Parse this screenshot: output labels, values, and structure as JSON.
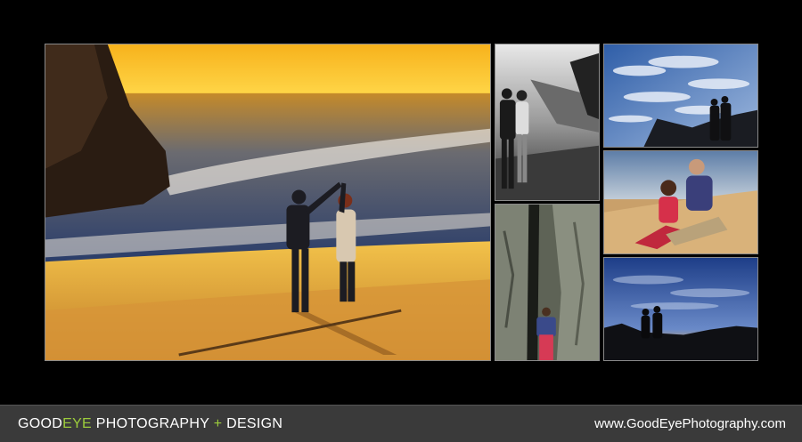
{
  "footer": {
    "brand_part1": "GOOD",
    "brand_part2": "EYE",
    "brand_part3": " PHOTOGRAPHY ",
    "brand_plus": "+",
    "brand_part4": " DESIGN",
    "website": "www.GoodEyePhotography.com"
  },
  "colors": {
    "background": "#000000",
    "footer_bar": "#3a3a3a",
    "accent_green": "#9ccc3c",
    "photo_border": "#8a8a8a"
  },
  "photos": [
    {
      "id": "sunset-beach-dance",
      "tone": "color"
    },
    {
      "id": "couple-kiss-bw",
      "tone": "black-and-white"
    },
    {
      "id": "couple-between-rocks",
      "tone": "color"
    },
    {
      "id": "couple-under-cloud-sky",
      "tone": "color"
    },
    {
      "id": "couple-sitting-on-sand",
      "tone": "color"
    },
    {
      "id": "silhouette-at-dusk",
      "tone": "color"
    }
  ]
}
